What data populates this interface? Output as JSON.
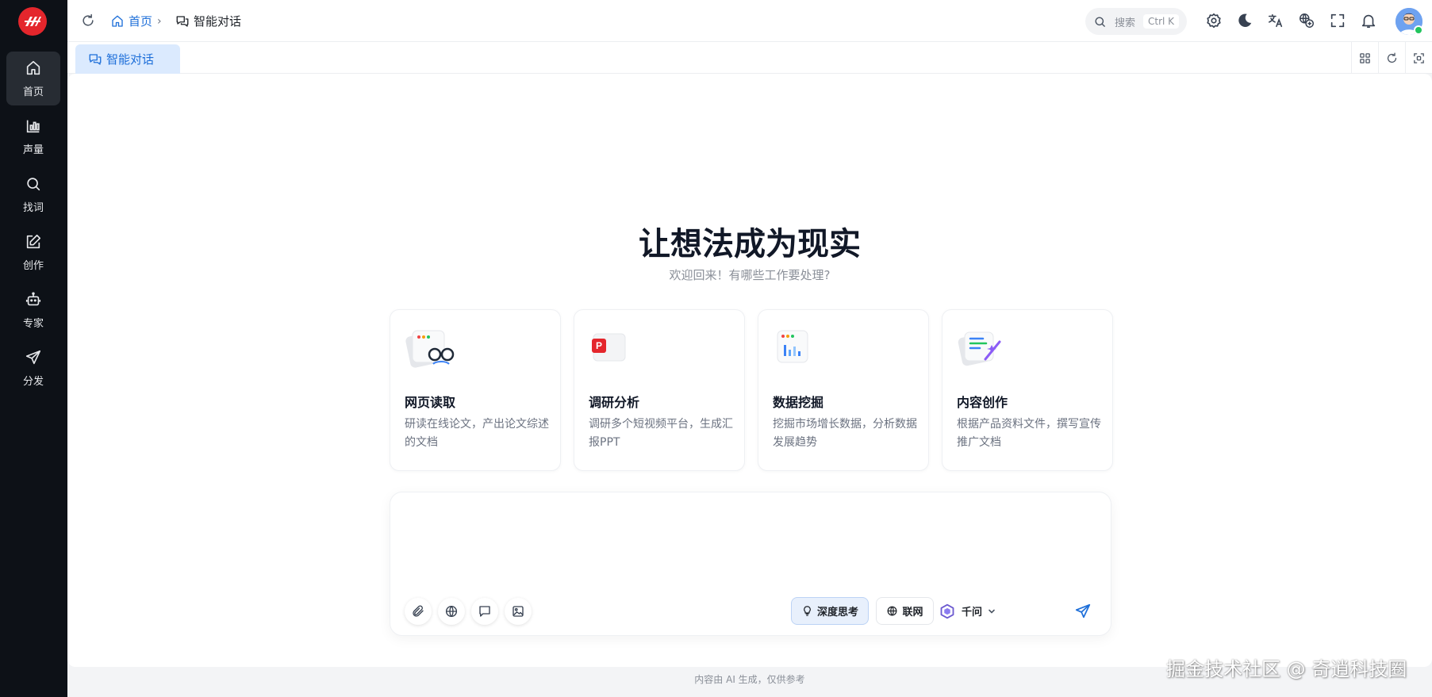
{
  "sidebar": {
    "logo_icon": "brand-logo-icon",
    "items": [
      {
        "label": "首页",
        "icon": "home-icon",
        "active": true
      },
      {
        "label": "声量",
        "icon": "bar-chart-icon"
      },
      {
        "label": "找词",
        "icon": "search-icon"
      },
      {
        "label": "创作",
        "icon": "edit-icon"
      },
      {
        "label": "专家",
        "icon": "robot-icon"
      },
      {
        "label": "分发",
        "icon": "send-icon"
      }
    ]
  },
  "header": {
    "breadcrumb": {
      "home": "首页",
      "separator": "›",
      "current": "智能对话"
    },
    "search": {
      "placeholder": "搜索",
      "shortcut": "Ctrl K"
    },
    "icons": [
      "settings-icon",
      "theme-moon-icon",
      "translate-icon",
      "language-globe-icon",
      "fullscreen-icon",
      "bell-icon",
      "avatar"
    ]
  },
  "tabs": [
    {
      "label": "智能对话",
      "active": true
    }
  ],
  "main": {
    "title": "让想法成为现实",
    "subtitle": "欢迎回来！有哪些工作要处理?",
    "cards": [
      {
        "title": "网页读取",
        "desc": "研读在线论文，产出论文综述的文档",
        "icon": "web-reader-icon"
      },
      {
        "title": "调研分析",
        "desc": "调研多个短视频平台，生成汇报PPT",
        "icon": "ppt-icon"
      },
      {
        "title": "数据挖掘",
        "desc": "挖掘市场增长数据，分析数据发展趋势",
        "icon": "data-chart-icon"
      },
      {
        "title": "内容创作",
        "desc": "根据产品资料文件，撰写宣传推广文档",
        "icon": "content-write-icon"
      }
    ],
    "composer": {
      "value": "",
      "deep_think": "深度思考",
      "web": "联网",
      "model": "千问"
    }
  },
  "footer": "内容由 AI 生成，仅供参考",
  "watermark": "掘金技术社区 @ 奇逍科技圈",
  "colors": {
    "accent": "#1e6fd9",
    "sidebar_bg": "#0d1117",
    "logo_red": "#e4262c"
  }
}
